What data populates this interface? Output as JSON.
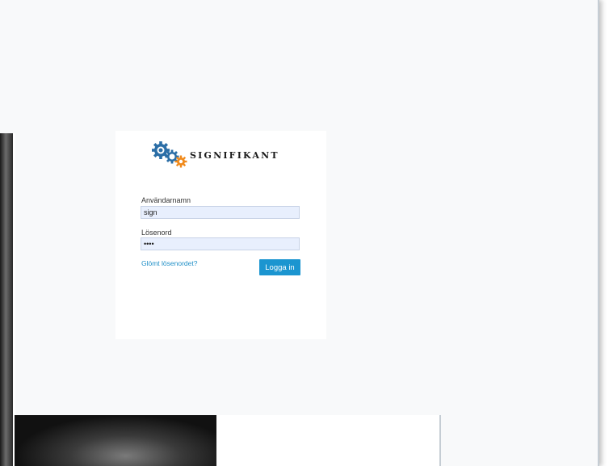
{
  "brand": {
    "name": "SIGNIFIKANT",
    "logo_icon": "gears-icon"
  },
  "login": {
    "username_label": "Användarnamn",
    "username_value": "sign",
    "password_label": "Lösenord",
    "password_value": "••••",
    "forgot_link": "Glömt lösenordet?",
    "submit_label": "Logga in"
  },
  "colors": {
    "accent": "#1b95d0",
    "link": "#1f8fc7",
    "gear_blue": "#2b6ea6",
    "gear_orange": "#f08a1c",
    "input_bg": "#e8effd"
  }
}
